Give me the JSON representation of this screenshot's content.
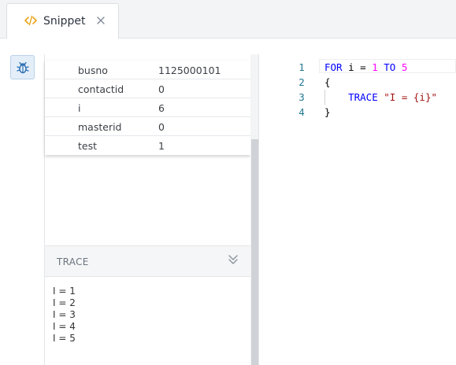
{
  "tab": {
    "label": "Snippet"
  },
  "variables": [
    {
      "name": "busno",
      "value": "1125000101"
    },
    {
      "name": "contactid",
      "value": "0"
    },
    {
      "name": "i",
      "value": "6"
    },
    {
      "name": "masterid",
      "value": "0"
    },
    {
      "name": "test",
      "value": "1"
    }
  ],
  "trace": {
    "title": "TRACE",
    "lines": [
      "I = 1",
      "I = 2",
      "I = 3",
      "I = 4",
      "I = 5"
    ]
  },
  "editor": {
    "line_numbers": [
      "1",
      "2",
      "3",
      "4"
    ],
    "line1": {
      "kw1": "FOR",
      "var": " i = ",
      "n1": "1",
      "kw2": " TO ",
      "n2": "5"
    },
    "line2": {
      "text": "{"
    },
    "line3": {
      "indent": "    ",
      "kw": "TRACE",
      "space": " ",
      "str": "\"I = {i}\""
    },
    "line4": {
      "text": "}"
    }
  },
  "colors": {
    "keyword": "#0000ff",
    "number": "#ff00ff",
    "string": "#a31515",
    "line_number": "#237893",
    "accent": "#e8a317"
  },
  "icons": {
    "tab": "code-icon",
    "close": "close-icon",
    "debug": "bug-icon",
    "collapse": "chevron-double-down-icon"
  }
}
